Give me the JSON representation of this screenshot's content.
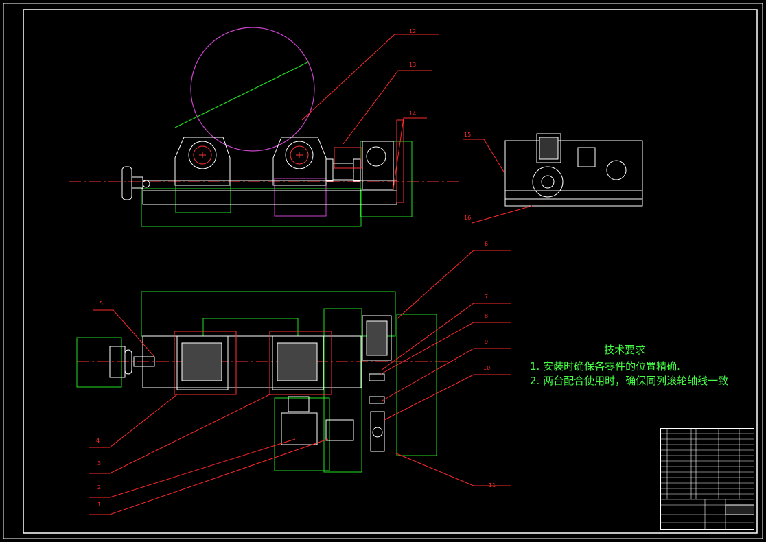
{
  "colors": {
    "background": "#000000",
    "frame": "#ffffff",
    "leader": "#ff2a2a",
    "boundary": "#22dd22",
    "workpiece": "#cc44cc",
    "centerline": "#ff3333",
    "notes_text": "#44ff44",
    "part_outline": "#ffffff"
  },
  "callouts": [
    "1",
    "2",
    "3",
    "4",
    "5",
    "6",
    "7",
    "8",
    "9",
    "10",
    "11",
    "12",
    "13",
    "14",
    "15",
    "16"
  ],
  "notes": {
    "title": "技术要求",
    "items": [
      "1. 安装时确保各零件的位置精确.",
      "2. 两台配合使用时，确保同列滚轮轴线一致"
    ]
  }
}
